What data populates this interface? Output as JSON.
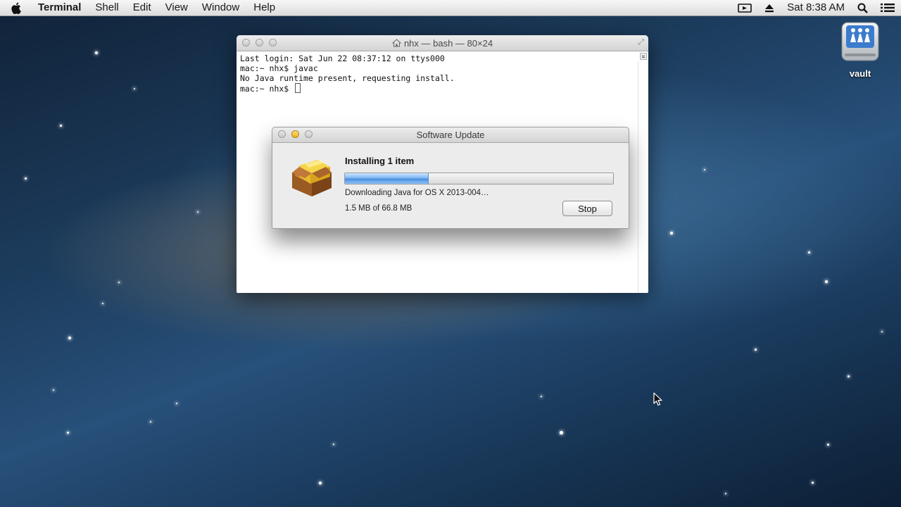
{
  "menubar": {
    "app_name": "Terminal",
    "items": [
      "Shell",
      "Edit",
      "View",
      "Window",
      "Help"
    ],
    "clock": "Sat 8:38 AM",
    "icons": [
      "apple-logo",
      "screen-record-icon",
      "eject-icon",
      "spotlight-search-icon",
      "notification-list-icon"
    ]
  },
  "desktop": {
    "disk_label": "vault"
  },
  "terminal": {
    "title": "nhx — bash — 80×24",
    "lines": [
      "Last login: Sat Jun 22 08:37:12 on ttys000",
      "mac:~ nhx$ javac",
      "No Java runtime present, requesting install.",
      "mac:~ nhx$ "
    ]
  },
  "software_update": {
    "title": "Software Update",
    "heading": "Installing 1 item",
    "status": "Downloading Java for OS X 2013-004…",
    "size": "1.5 MB of 66.8 MB",
    "progress_fraction": 0.31,
    "stop_label": "Stop"
  },
  "colors": {
    "progress_blue": "#4a8fdf",
    "menubar_bg": "#dcdcdc"
  }
}
